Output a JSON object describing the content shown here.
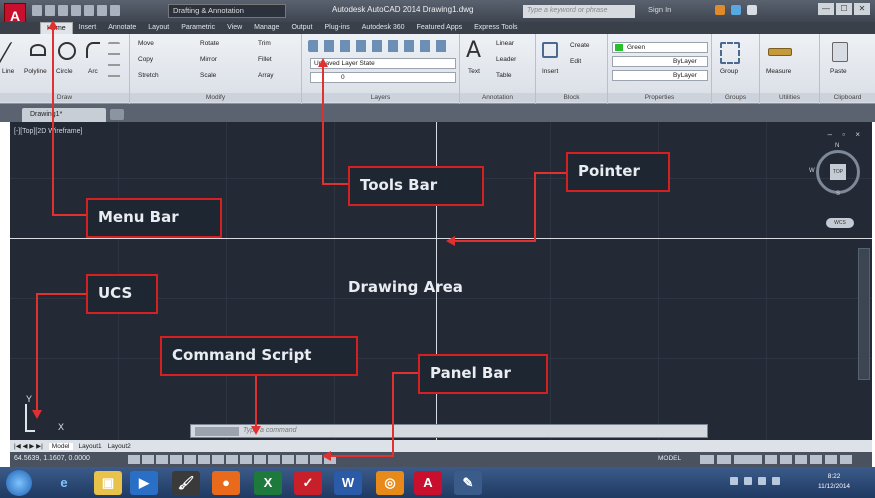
{
  "titlebar": {
    "app_letter": "A",
    "workspace": "Drafting & Annotation",
    "window_title": "Autodesk AutoCAD 2014    Drawing1.dwg",
    "search_placeholder": "Type a keyword or phrase",
    "signin": "Sign In",
    "win_min": "—",
    "win_max": "☐",
    "win_close": "✕"
  },
  "ribbon_tabs": [
    "Home",
    "Insert",
    "Annotate",
    "Layout",
    "Parametric",
    "View",
    "Manage",
    "Output",
    "Plug-ins",
    "Autodesk 360",
    "Featured Apps",
    "Express Tools"
  ],
  "ribbon": {
    "draw": {
      "title": "Draw",
      "tools": [
        "Line",
        "Polyline",
        "Circle",
        "Arc"
      ]
    },
    "modify": {
      "title": "Modify",
      "tools": [
        "Move",
        "Rotate",
        "Trim",
        "Copy",
        "Mirror",
        "Fillet",
        "Stretch",
        "Scale",
        "Array"
      ]
    },
    "layers": {
      "title": "Layers",
      "layer_state": "Unsaved Layer State",
      "current_layer": "0"
    },
    "annotation": {
      "title": "Annotation",
      "tools": [
        "Text",
        "Linear",
        "Leader",
        "Table"
      ]
    },
    "block": {
      "title": "Block",
      "tools": [
        "Insert",
        "Create",
        "Edit"
      ]
    },
    "properties": {
      "title": "Properties",
      "color": "Green",
      "linetype": "ByLayer",
      "lineweight": "ByLayer"
    },
    "groups": {
      "title": "Groups",
      "tools": [
        "Group"
      ]
    },
    "utilities": {
      "title": "Utilities",
      "tools": [
        "Measure"
      ]
    },
    "clipboard": {
      "title": "Clipboard",
      "tools": [
        "Paste"
      ]
    }
  },
  "file_tab": "Drawing1*",
  "drawing": {
    "viewport_label": "[-][Top][2D Wireframe]",
    "viewport_controls": "– ▫ ×",
    "viewcube": {
      "top": "TOP",
      "n": "N",
      "s": "S",
      "w": "W",
      "wcs": "WCS"
    },
    "ucs_y": "Y",
    "ucs_x": "X",
    "command_placeholder": "Type a command"
  },
  "layout_tabs": [
    "Model",
    "Layout1",
    "Layout2"
  ],
  "layout_nav": "|◀ ◀ ▶ ▶|",
  "status": {
    "coords": "64.5639, 1.1607, 0.0000",
    "model": "MODEL"
  },
  "taskbar": {
    "apps": [
      "e",
      "▣",
      "▶",
      "🖌",
      "●",
      "X",
      "✓",
      "W",
      "◎",
      "A",
      "✎"
    ],
    "date": "11/12/2014",
    "time": "8:22"
  },
  "annotations": {
    "menu_bar": "Menu Bar",
    "tools_bar": "Tools Bar",
    "pointer": "Pointer",
    "ucs": "UCS",
    "drawing_area": "Drawing Area",
    "command_script": "Command Script",
    "panel_bar": "Panel Bar"
  },
  "colors": {
    "annotation_border": "#d42020",
    "drawing_bg": "#232a36",
    "autocad_red": "#c8102e"
  }
}
